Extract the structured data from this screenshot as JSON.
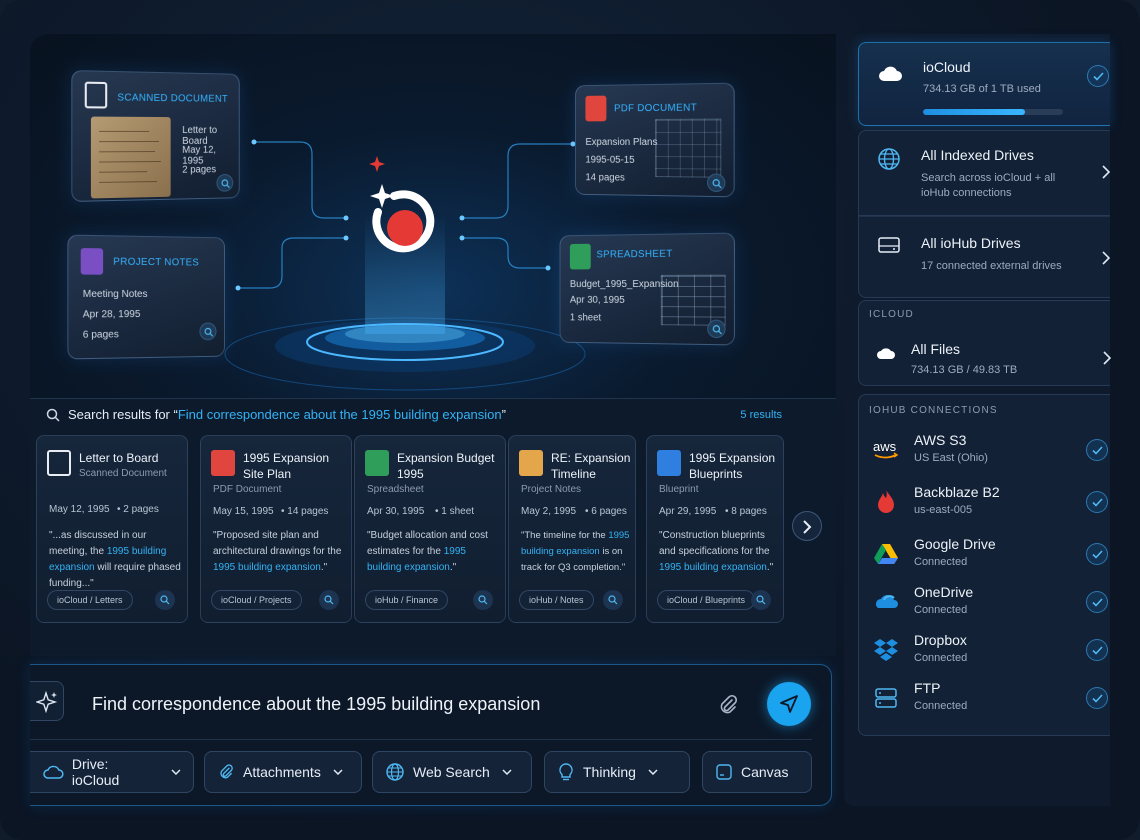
{
  "hero": {
    "cards": [
      {
        "title": "SCANNED DOCUMENT",
        "lines": [
          "Letter to Board",
          "May 12, 1995",
          "2 pages"
        ]
      },
      {
        "title": "PDF DOCUMENT",
        "lines": [
          "Expansion Plans",
          "1995-05-15",
          "14 pages"
        ]
      },
      {
        "title": "PROJECT NOTES",
        "lines": [
          "Meeting Notes",
          "Apr 28, 1995",
          "6 pages"
        ]
      },
      {
        "title": "SPREADSHEET",
        "lines": [
          "Budget_1995_Expansion",
          "Apr 30, 1995",
          "1 sheet"
        ]
      }
    ]
  },
  "results": {
    "prefix": "Search results for “",
    "query": "Find correspondence about the 1995 building expansion",
    "suffix": "”",
    "count": "5 results",
    "items": [
      {
        "title": "Letter to Board",
        "type": "Scanned Document",
        "date": "May 12, 1995",
        "pages": "• 2 pages",
        "snip_a": "\"...as discussed in our meeting, the ",
        "snip_hl": "1995 building expansion",
        "snip_b": " will require phased funding...\"",
        "tag": "ioCloud / Letters",
        "icon_color": "#e8edf3"
      },
      {
        "title": "1995 Expansion Site Plan",
        "type": "PDF Document",
        "date": "May 15, 1995",
        "pages": "• 14 pages",
        "snip_a": "\"Proposed site plan and architectural drawings for the ",
        "snip_hl": "1995 building expansion",
        "snip_b": ".\"",
        "tag": "ioCloud / Projects",
        "icon_color": "#e0463d"
      },
      {
        "title": "Expansion Budget 1995",
        "type": "Spreadsheet",
        "date": "Apr 30, 1995",
        "pages": "• 1 sheet",
        "snip_a": "\"Budget allocation and cost estimates for the ",
        "snip_hl": "1995 building expansion",
        "snip_b": ".\"",
        "tag": "ioHub / Finance",
        "icon_color": "#2f9e5b"
      },
      {
        "title": "RE: Expansion Timeline",
        "type": "Project Notes",
        "date": "May 2, 1995",
        "pages": "• 6 pages",
        "snip_a": "\"The timeline for the ",
        "snip_hl": "1995 building expansion",
        "snip_b": " is on track for Q3 completion.\"",
        "tag": "ioHub / Notes",
        "icon_color": "#e3a64a"
      },
      {
        "title": "1995 Expansion Blueprints",
        "type": "Blueprint",
        "date": "Apr 29, 1995",
        "pages": "• 8 pages",
        "snip_a": "\"Construction blueprints and specifications for the ",
        "snip_hl": "1995 building expansion",
        "snip_b": ".\"",
        "tag": "ioCloud / Blueprints",
        "icon_color": "#2e7fe0"
      }
    ]
  },
  "prompt": {
    "value": "Find correspondence about the 1995 building expansion",
    "chips": [
      {
        "label": "Drive: ioCloud",
        "icon": "cloud-icon"
      },
      {
        "label": "Attachments",
        "icon": "paperclip-icon"
      },
      {
        "label": "Web Search",
        "icon": "globe-icon"
      },
      {
        "label": "Thinking",
        "icon": "lightbulb-icon"
      },
      {
        "label": "Canvas",
        "icon": "canvas-icon"
      }
    ]
  },
  "sidebar": {
    "top": {
      "title": "ioCloud",
      "usage": "734.13 GB of 1 TB used",
      "usage_fraction": 0.73
    },
    "indexed": {
      "title": "All Indexed Drives",
      "sub": "Search across ioCloud + all ioHub connections"
    },
    "iohub": {
      "title": "All ioHub Drives",
      "sub": "17 connected external drives"
    },
    "icloud_label": "ICLOUD",
    "all_files": {
      "title": "All Files",
      "sub": "734.13 GB / 49.83 TB"
    },
    "connections_label": "IOHUB CONNECTIONS",
    "connections": [
      {
        "name": "AWS S3",
        "sub": "US East (Ohio)",
        "logo": "aws-logo"
      },
      {
        "name": "Backblaze B2",
        "sub": "us-east-005",
        "logo": "backblaze-logo"
      },
      {
        "name": "Google Drive",
        "sub": "Connected",
        "logo": "google-drive-logo"
      },
      {
        "name": "OneDrive",
        "sub": "Connected",
        "logo": "onedrive-logo"
      },
      {
        "name": "Dropbox",
        "sub": "Connected",
        "logo": "dropbox-logo"
      },
      {
        "name": "FTP",
        "sub": "Connected",
        "logo": "ftp-icon"
      }
    ],
    "aws_text": "aws"
  },
  "colors": {
    "accent": "#1aa3ee",
    "brand_red": "#e53935",
    "bg": "#0b1524"
  }
}
